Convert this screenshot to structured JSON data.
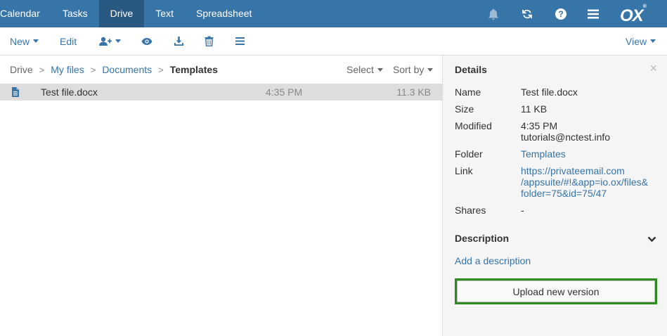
{
  "topbar": {
    "apps": [
      "Calendar",
      "Tasks",
      "Drive",
      "Text",
      "Spreadsheet"
    ],
    "active_app": "Drive",
    "icons": [
      "bell-icon",
      "refresh-icon",
      "help-icon",
      "menu-icon"
    ],
    "logo": "OX",
    "logo_mark": "®"
  },
  "toolbar": {
    "new_label": "New",
    "edit_label": "Edit",
    "icons": [
      "share-icon",
      "view-icon",
      "download-icon",
      "trash-icon",
      "more-icon"
    ],
    "view_label": "View"
  },
  "breadcrumb": {
    "items": [
      "Drive",
      "My files",
      "Documents",
      "Templates"
    ],
    "separator": ">"
  },
  "sort": {
    "select_label": "Select",
    "sortby_label": "Sort by"
  },
  "files": [
    {
      "name": "Test file.docx",
      "time": "4:35 PM",
      "size": "11.3 KB",
      "icon": "document-icon"
    }
  ],
  "details": {
    "title": "Details",
    "close": "×",
    "name_label": "Name",
    "name_value": "Test file.docx",
    "size_label": "Size",
    "size_value": "11 KB",
    "modified_label": "Modified",
    "modified_time": "4:35 PM",
    "modified_by": "tutorials@nctest.info",
    "folder_label": "Folder",
    "folder_value": "Templates",
    "link_label": "Link",
    "link_line1": "https://privateemail.com",
    "link_line2": "/appsuite/#!&app=io.ox/files&",
    "link_line3": "folder=75&id=75/47",
    "shares_label": "Shares",
    "shares_value": "-",
    "description_title": "Description",
    "add_description": "Add a description",
    "upload_label": "Upload new version"
  },
  "colors": {
    "topbar": "#3774a8",
    "active_tab": "#295880",
    "link": "#3774a8",
    "highlight_border": "#2e8b1f"
  }
}
